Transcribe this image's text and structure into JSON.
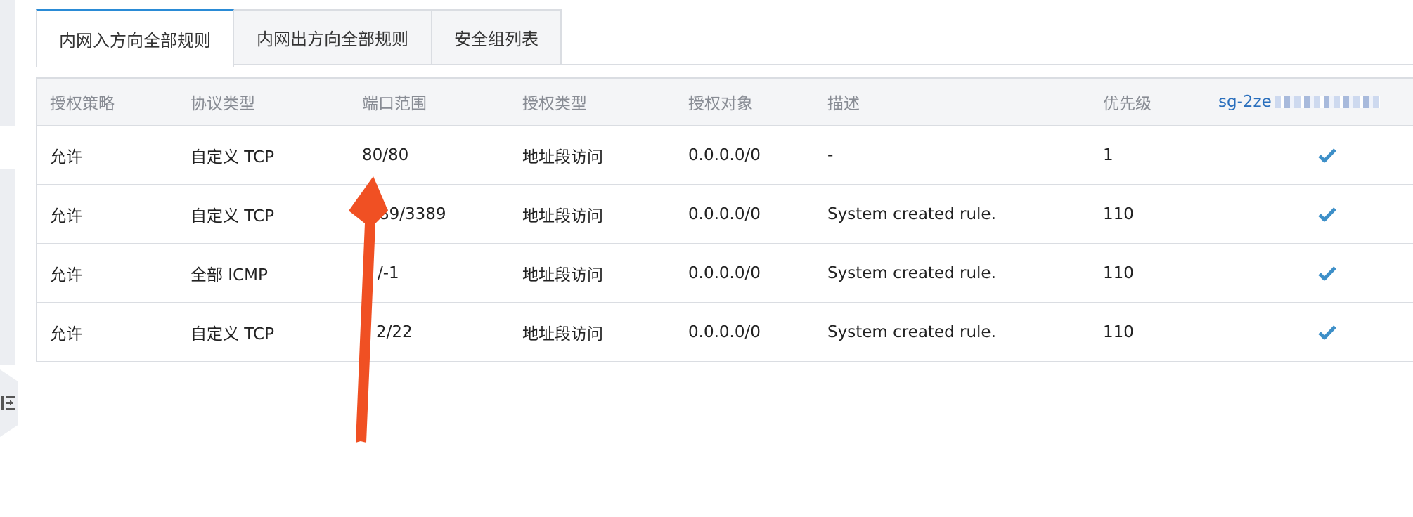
{
  "tabs": [
    {
      "label": "内网入方向全部规则"
    },
    {
      "label": "内网出方向全部规则"
    },
    {
      "label": "安全组列表"
    }
  ],
  "table": {
    "headers": [
      "授权策略",
      "协议类型",
      "端口范围",
      "授权类型",
      "授权对象",
      "描述",
      "优先级",
      "sg-2ze"
    ],
    "rows": [
      {
        "policy": "允许",
        "protocol": "自定义 TCP",
        "port": "80/80",
        "auth_type": "地址段访问",
        "target": "0.0.0.0/0",
        "desc": "-",
        "priority": "1"
      },
      {
        "policy": "允许",
        "protocol": "自定义 TCP",
        "port": "89/3389",
        "auth_type": "地址段访问",
        "target": "0.0.0.0/0",
        "desc": "System created rule.",
        "priority": "110"
      },
      {
        "policy": "允许",
        "protocol": "全部 ICMP",
        "port": "/-1",
        "auth_type": "地址段访问",
        "target": "0.0.0.0/0",
        "desc": "System created rule.",
        "priority": "110"
      },
      {
        "policy": "允许",
        "protocol": "自定义 TCP",
        "port": "2/22",
        "auth_type": "地址段访问",
        "target": "0.0.0.0/0",
        "desc": "System created rule.",
        "priority": "110"
      }
    ]
  },
  "colors": {
    "accent": "#2a8bd6",
    "check": "#3d8fc8",
    "arrow": "#f05023"
  },
  "icons": [
    "check-icon",
    "collapse-menu-icon",
    "annotation-arrow"
  ]
}
